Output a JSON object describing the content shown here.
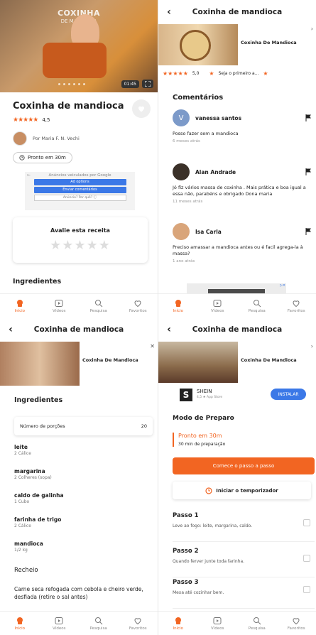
{
  "app": {
    "accent_color": "#f26522",
    "recipe_title": "Coxinha de mandioca"
  },
  "nav": {
    "items": [
      {
        "label": "Início",
        "icon": "chef-hat-icon"
      },
      {
        "label": "Vídeos",
        "icon": "play-icon"
      },
      {
        "label": "Pesquisa",
        "icon": "search-icon"
      },
      {
        "label": "Favoritos",
        "icon": "heart-icon"
      }
    ]
  },
  "video_ad": {
    "label": "Coxinha De Mandioca"
  },
  "panel1": {
    "hero_title": "COXINHA",
    "hero_subtitle": "DE MANDIOCA",
    "video_time": "01:45",
    "rating": "4,5",
    "author": "Por Maria F. N. Vechi",
    "ready": "Pronto em 30m",
    "ad": {
      "header": "Anúncios veiculados por Google",
      "btn1": "Ad options",
      "btn2": "Enviar comentários",
      "btn3": "Anúncio? Por quê? ⓘ"
    },
    "rate_label": "Avalie esta receita",
    "ingredients_heading": "Ingredientes"
  },
  "panel2": {
    "rating": "5,0",
    "first_note": "Seja o primeiro a...",
    "comments_heading": "Comentários",
    "comments": [
      {
        "initial": "V",
        "name": "vanessa santos",
        "text": "Posso fazer sem a mandioca",
        "date": "6 meses atrás"
      },
      {
        "initial": "",
        "name": "Alan Andrade",
        "text": "Jó fiz vários massa de coxinha . Mais prática e boa igual a essa não, parabéns e obrigado Dona maria",
        "date": "11 meses atrás"
      },
      {
        "initial": "",
        "name": "Isa Carla",
        "text": "Preciso amassar a mandioca antes ou é facil agrega-la à massa?",
        "date": "1 ano atrás"
      }
    ]
  },
  "panel3": {
    "heading": "Ingredientes",
    "portions_label": "Número de porções",
    "portions_value": "20",
    "ingredients": [
      {
        "name": "leite",
        "qty": "2 Cálice"
      },
      {
        "name": "margarina",
        "qty": "2 Colheres (sopa)"
      },
      {
        "name": "caldo de galinha",
        "qty": "1 Cubo"
      },
      {
        "name": "farinha de trigo",
        "qty": "2 Cálice"
      },
      {
        "name": "mandioca",
        "qty": "1/2 kg"
      }
    ],
    "filling_heading": "Recheio",
    "filling_text": "Carne seca refogada com cebola e cheiro verde, desfiada (retire o sal antes)"
  },
  "panel4": {
    "shein": {
      "name": "SHEIN",
      "sub": "4,5 ★ App Store",
      "install": "INSTALAR",
      "logo": "S"
    },
    "method_heading": "Modo de Preparo",
    "ready": "Pronto em 30m",
    "prep": "30 min de preparação",
    "cta": "Comece o passo a passo",
    "timer": "Iniciar o temporizador",
    "steps": [
      {
        "title": "Passo 1",
        "desc": "Leve ao fogo: leite, margarina, caldo."
      },
      {
        "title": "Passo 2",
        "desc": "Quando ferver junte toda farinha."
      },
      {
        "title": "Passo 3",
        "desc": "Mexa até cozinhar bem."
      }
    ]
  }
}
